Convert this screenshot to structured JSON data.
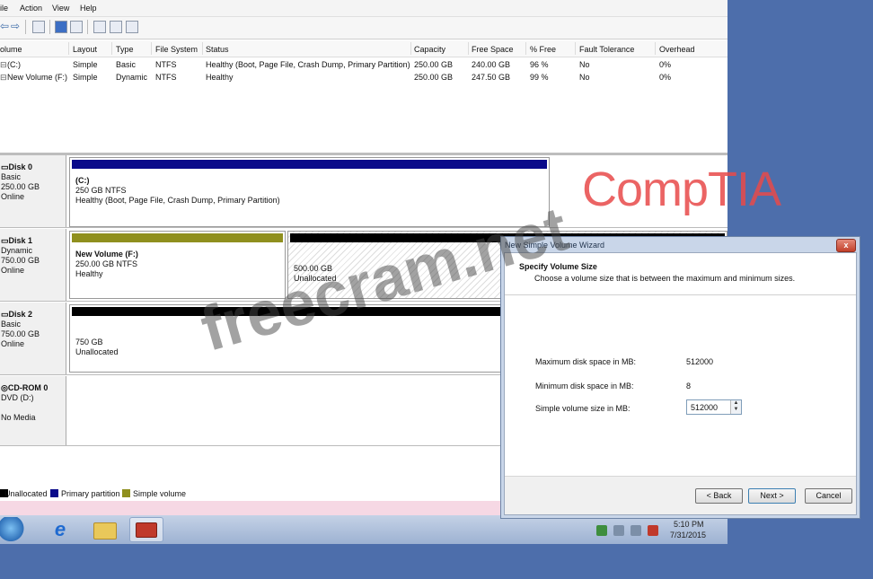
{
  "menu": {
    "items": [
      "ile",
      "Action",
      "View",
      "Help"
    ]
  },
  "volume_table": {
    "columns": [
      "olume",
      "Layout",
      "Type",
      "File System",
      "Status",
      "Capacity",
      "Free Space",
      "% Free",
      "Fault Tolerance",
      "Overhead"
    ],
    "rows": [
      [
        "(C:)",
        "Simple",
        "Basic",
        "NTFS",
        "Healthy (Boot, Page File, Crash Dump, Primary Partition)",
        "250.00 GB",
        "240.00 GB",
        "96 %",
        "No",
        "0%"
      ],
      [
        "New Volume (F:)",
        "Simple",
        "Dynamic",
        "NTFS",
        "Healthy",
        "250.00 GB",
        "247.50 GB",
        "99 %",
        "No",
        "0%"
      ]
    ]
  },
  "disks": [
    {
      "name": "Disk 0",
      "type": "Basic",
      "size": "250.00 GB",
      "status": "Online",
      "partitions": [
        {
          "title": "(C:)",
          "size": "250 GB NTFS",
          "status": "Healthy (Boot, Page File, Crash Dump, Primary Partition)"
        }
      ]
    },
    {
      "name": "Disk 1",
      "type": "Dynamic",
      "size": "750.00 GB",
      "status": "Online",
      "partitions": [
        {
          "title": "New Volume (F:)",
          "size": "250.00 GB NTFS",
          "status": "Healthy"
        },
        {
          "size": "500.00 GB",
          "status": "Unallocated"
        }
      ]
    },
    {
      "name": "Disk 2",
      "type": "Basic",
      "size": "750.00 GB",
      "status": "Online",
      "partitions": [
        {
          "size": "750 GB",
          "status": "Unallocated"
        }
      ]
    },
    {
      "name": "CD-ROM 0",
      "type": "DVD (D:)",
      "status": "No Media"
    }
  ],
  "legend": [
    {
      "label": "Unallocated",
      "color": "#000000"
    },
    {
      "label": "Primary partition",
      "color": "#0a0a8a"
    },
    {
      "label": "Simple volume",
      "color": "#8f8f1e"
    }
  ],
  "wizard": {
    "title": "New Simple Volume Wizard",
    "close": "x",
    "heading": "Specify Volume Size",
    "subheading": "Choose a volume size that is between the maximum and minimum sizes.",
    "max_label": "Maximum disk space in MB:",
    "max_value": "512000",
    "min_label": "Minimum disk space in MB:",
    "min_value": "8",
    "size_label": "Simple volume size in MB:",
    "size_value": "512000",
    "back": "< Back",
    "next": "Next >",
    "cancel": "Cancel"
  },
  "taskbar": {
    "time": "5:10 PM",
    "date": "7/31/2015"
  },
  "branding": {
    "logo": "CompTIA",
    "watermark": "freecram.net"
  }
}
